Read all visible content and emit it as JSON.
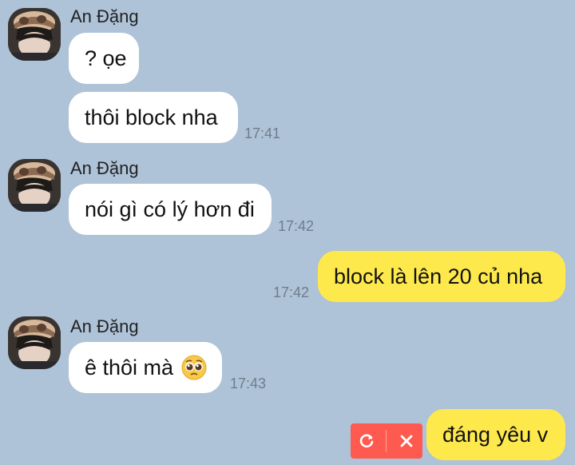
{
  "colors": {
    "background": "#aec2d8",
    "incoming_bubble": "#ffffff",
    "outgoing_bubble": "#fee94d",
    "retry_panel": "#ff5a4f",
    "timestamp": "#6f7d8a"
  },
  "messages": [
    {
      "sender": "An Đặng",
      "text": "? ọe",
      "time": ""
    },
    {
      "sender": "",
      "text": "thôi block nha",
      "time": "17:41"
    },
    {
      "sender": "An Đặng",
      "text": "nói gì có lý hơn đi",
      "time": "17:42"
    },
    {
      "sender": "",
      "text": "block là lên 20 củ nha",
      "time": "17:42"
    },
    {
      "sender": "An Đặng",
      "text": "ê thôi mà",
      "emoji": "pleading-face-emoji",
      "time": "17:43"
    },
    {
      "sender": "",
      "text": "đáng yêu v",
      "time": ""
    }
  ],
  "failed_message_actions": {
    "retry_icon": "retry-icon",
    "delete_icon": "close-icon"
  }
}
